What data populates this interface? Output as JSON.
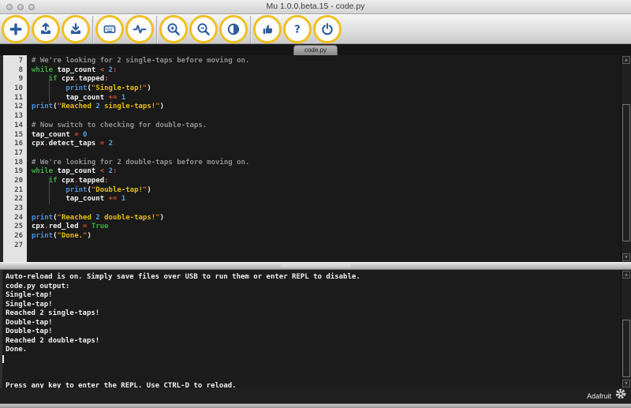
{
  "window": {
    "title": "Mu 1.0.0.beta.15 - code.py"
  },
  "titlebar": {
    "buttons": [
      {
        "name": "close-button",
        "icon": "traffic-light-icon"
      },
      {
        "name": "minimize-button",
        "icon": "traffic-light-icon"
      },
      {
        "name": "zoom-window-button",
        "icon": "traffic-light-icon"
      }
    ]
  },
  "toolbar": {
    "accent_ring_color": "#f0c021",
    "icon_color": "#2a5d9f",
    "groups": [
      [
        {
          "name": "new-button",
          "icon": "plus-icon"
        },
        {
          "name": "load-button",
          "icon": "load-icon"
        },
        {
          "name": "save-button",
          "icon": "save-icon"
        }
      ],
      [
        {
          "name": "serial-button",
          "icon": "keyboard-icon"
        },
        {
          "name": "plotter-button",
          "icon": "pulse-icon"
        }
      ],
      [
        {
          "name": "zoom-in-button",
          "icon": "zoom-in-icon"
        },
        {
          "name": "zoom-out-button",
          "icon": "zoom-out-icon"
        },
        {
          "name": "theme-button",
          "icon": "contrast-icon"
        }
      ],
      [
        {
          "name": "check-button",
          "icon": "thumbs-up-icon"
        },
        {
          "name": "help-button",
          "icon": "question-icon"
        },
        {
          "name": "quit-button",
          "icon": "power-icon"
        }
      ]
    ]
  },
  "tab": {
    "label": "code.py"
  },
  "editor": {
    "colors": {
      "cm": "#8f8f8f",
      "kw": "#3caa3c",
      "bi": "#4e8fd5",
      "nu": "#55a0e6",
      "op": "#e04a2f",
      "qt": "#e0762e",
      "st": "#e5bd0c",
      "id": "#f2f2f2",
      "pa": "#e8e8e8"
    },
    "lines": [
      {
        "num": 7,
        "tokens": [
          [
            "cm",
            "# We're looking for 2 single-taps before moving on."
          ]
        ]
      },
      {
        "num": 8,
        "tokens": [
          [
            "kw",
            "while"
          ],
          [
            "id",
            " tap_count "
          ],
          [
            "op",
            "<"
          ],
          [
            "id",
            " "
          ],
          [
            "nu",
            "2"
          ],
          [
            "op",
            ":"
          ]
        ]
      },
      {
        "num": 9,
        "tokens": [
          [
            "id",
            "    "
          ],
          [
            "kw",
            "if"
          ],
          [
            "id",
            " cpx"
          ],
          [
            "op",
            "."
          ],
          [
            "id",
            "tapped"
          ],
          [
            "op",
            ":"
          ]
        ]
      },
      {
        "num": 10,
        "tokens": [
          [
            "id",
            "        "
          ],
          [
            "bi",
            "print"
          ],
          [
            "pa",
            "("
          ],
          [
            "qt",
            "\""
          ],
          [
            "st",
            "Single-tap!"
          ],
          [
            "qt",
            "\""
          ],
          [
            "pa",
            ")"
          ]
        ]
      },
      {
        "num": 11,
        "tokens": [
          [
            "id",
            "        tap_count "
          ],
          [
            "op",
            "+="
          ],
          [
            "id",
            " "
          ],
          [
            "nu",
            "1"
          ]
        ]
      },
      {
        "num": 12,
        "tokens": [
          [
            "bi",
            "print"
          ],
          [
            "pa",
            "("
          ],
          [
            "qt",
            "\""
          ],
          [
            "st",
            "Reached "
          ],
          [
            "nu",
            "2"
          ],
          [
            "st",
            " single-taps!"
          ],
          [
            "qt",
            "\""
          ],
          [
            "pa",
            ")"
          ]
        ]
      },
      {
        "num": 13,
        "tokens": []
      },
      {
        "num": 14,
        "tokens": [
          [
            "cm",
            "# Now switch to checking for double-taps."
          ]
        ]
      },
      {
        "num": 15,
        "tokens": [
          [
            "id",
            "tap_count "
          ],
          [
            "op",
            "="
          ],
          [
            "id",
            " "
          ],
          [
            "nu",
            "0"
          ]
        ]
      },
      {
        "num": 16,
        "tokens": [
          [
            "id",
            "cpx"
          ],
          [
            "op",
            "."
          ],
          [
            "id",
            "detect_taps "
          ],
          [
            "op",
            "="
          ],
          [
            "id",
            " "
          ],
          [
            "nu",
            "2"
          ]
        ]
      },
      {
        "num": 17,
        "tokens": []
      },
      {
        "num": 18,
        "tokens": [
          [
            "cm",
            "# We're looking for 2 double-taps before moving on."
          ]
        ]
      },
      {
        "num": 19,
        "tokens": [
          [
            "kw",
            "while"
          ],
          [
            "id",
            " tap_count "
          ],
          [
            "op",
            "<"
          ],
          [
            "id",
            " "
          ],
          [
            "nu",
            "2"
          ],
          [
            "op",
            ":"
          ]
        ]
      },
      {
        "num": 20,
        "tokens": [
          [
            "id",
            "    "
          ],
          [
            "kw",
            "if"
          ],
          [
            "id",
            " cpx"
          ],
          [
            "op",
            "."
          ],
          [
            "id",
            "tapped"
          ],
          [
            "op",
            ":"
          ]
        ]
      },
      {
        "num": 21,
        "tokens": [
          [
            "id",
            "        "
          ],
          [
            "bi",
            "print"
          ],
          [
            "pa",
            "("
          ],
          [
            "qt",
            "\""
          ],
          [
            "st",
            "Double-tap!"
          ],
          [
            "qt",
            "\""
          ],
          [
            "pa",
            ")"
          ]
        ]
      },
      {
        "num": 22,
        "tokens": [
          [
            "id",
            "        tap_count "
          ],
          [
            "op",
            "+="
          ],
          [
            "id",
            " "
          ],
          [
            "nu",
            "1"
          ]
        ]
      },
      {
        "num": 23,
        "tokens": []
      },
      {
        "num": 24,
        "tokens": [
          [
            "bi",
            "print"
          ],
          [
            "pa",
            "("
          ],
          [
            "qt",
            "\""
          ],
          [
            "st",
            "Reached "
          ],
          [
            "nu",
            "2"
          ],
          [
            "st",
            " double-taps!"
          ],
          [
            "qt",
            "\""
          ],
          [
            "pa",
            ")"
          ]
        ]
      },
      {
        "num": 25,
        "tokens": [
          [
            "id",
            "cpx"
          ],
          [
            "op",
            "."
          ],
          [
            "id",
            "red_led "
          ],
          [
            "op",
            "="
          ],
          [
            "id",
            " "
          ],
          [
            "kw",
            "True"
          ]
        ]
      },
      {
        "num": 26,
        "tokens": [
          [
            "bi",
            "print"
          ],
          [
            "pa",
            "("
          ],
          [
            "qt",
            "\""
          ],
          [
            "st",
            "Done."
          ],
          [
            "qt",
            "\""
          ],
          [
            "pa",
            ")"
          ]
        ]
      },
      {
        "num": 27,
        "tokens": []
      }
    ]
  },
  "repl": {
    "lines": [
      "Auto-reload is on. Simply save files over USB to run them or enter REPL to disable.",
      "code.py output:",
      "Single-tap!",
      "Single-tap!",
      "Reached 2 single-taps!",
      "Double-tap!",
      "Double-tap!",
      "Reached 2 double-taps!",
      "Done.",
      "",
      "",
      "",
      "Press any key to enter the REPL. Use CTRL-D to reload."
    ]
  },
  "statusbar": {
    "brand": "Adafruit",
    "icons": [
      "gear-icon"
    ]
  }
}
